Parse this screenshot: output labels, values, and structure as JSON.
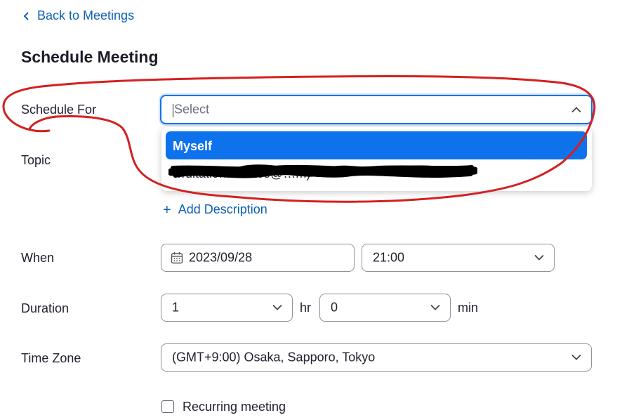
{
  "nav": {
    "back_label": "Back to Meetings"
  },
  "page": {
    "title": "Schedule Meeting"
  },
  "form": {
    "schedule_for": {
      "label": "Schedule For",
      "placeholder": "Select",
      "options": [
        {
          "label": "Myself",
          "highlighted": true
        },
        {
          "label": "…ultation-service@…m)",
          "redacted": true
        }
      ]
    },
    "topic": {
      "label": "Topic"
    },
    "description": {
      "add_label": "Add Description"
    },
    "when": {
      "label": "When",
      "date": "2023/09/28",
      "time": "21:00"
    },
    "duration": {
      "label": "Duration",
      "hours": "1",
      "hours_unit": "hr",
      "minutes": "0",
      "minutes_unit": "min"
    },
    "time_zone": {
      "label": "Time Zone",
      "value": "(GMT+9:00) Osaka, Sapporo, Tokyo"
    },
    "recurring": {
      "label": "Recurring meeting",
      "checked": false
    }
  },
  "colors": {
    "accent": "#0e72ed",
    "link": "#0e5fb3",
    "annotation": "#d42020",
    "redaction": "#000000"
  },
  "icons": [
    "chevron-left-icon",
    "chevron-up-icon",
    "chevron-down-icon",
    "plus-icon",
    "calendar-icon"
  ]
}
